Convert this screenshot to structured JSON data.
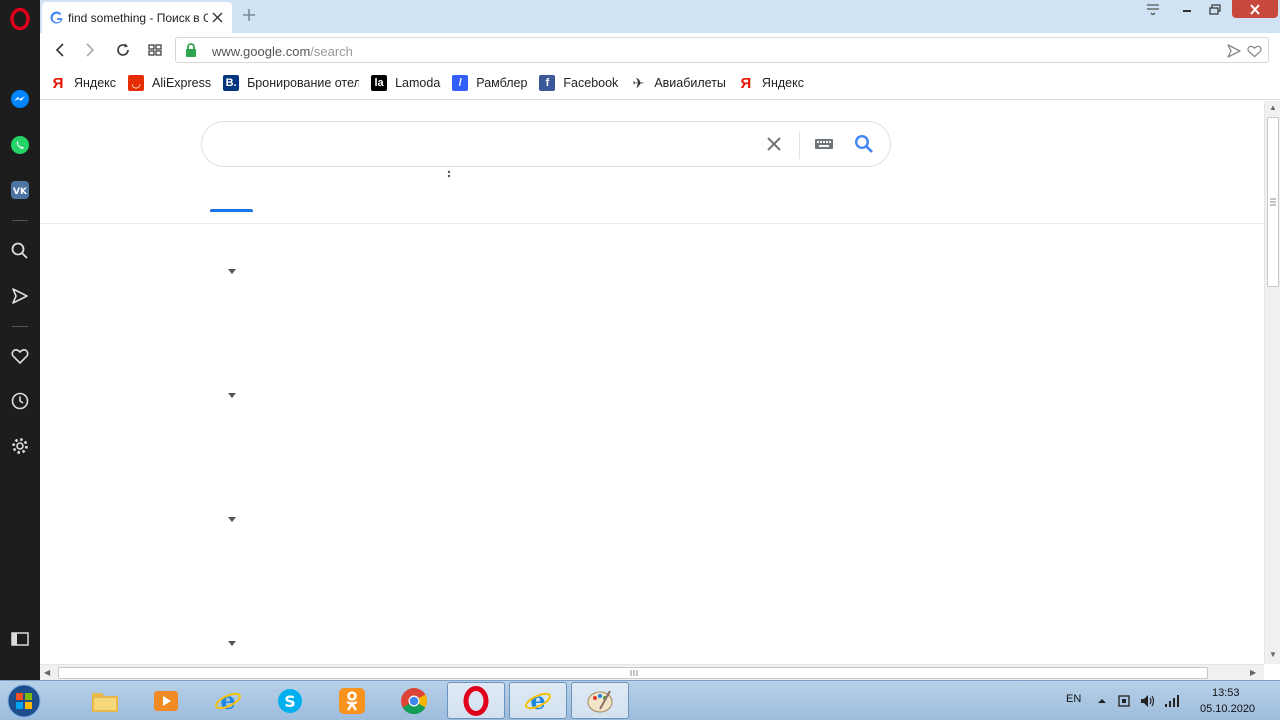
{
  "browser": {
    "tab": {
      "title": "find something - Поиск в Google",
      "favicon": "G"
    },
    "address": {
      "host": "www.google.com",
      "path": "/search"
    },
    "bookmarks": [
      {
        "label": "Яндекс",
        "icon": "yandex-icon",
        "color": "#e61400",
        "glyph": "Я"
      },
      {
        "label": "AliExpress",
        "icon": "aliexpress-icon",
        "color": "#e62e04",
        "glyph": "◡"
      },
      {
        "label": "Бронирование отелей",
        "icon": "booking-icon",
        "color": "#003580",
        "glyph": "B."
      },
      {
        "label": "Lamoda",
        "icon": "lamoda-icon",
        "color": "#000000",
        "glyph": "la"
      },
      {
        "label": "Рамблер",
        "icon": "rambler-icon",
        "color": "#315efb",
        "glyph": "/"
      },
      {
        "label": "Facebook",
        "icon": "facebook-icon",
        "color": "#3b5998",
        "glyph": "f"
      },
      {
        "label": "Авиабилеты",
        "icon": "plane-icon",
        "color": "#f5a623",
        "glyph": "✈"
      },
      {
        "label": "Яндекс",
        "icon": "yandex-icon",
        "color": "#e61400",
        "glyph": "Я"
      }
    ]
  },
  "search": {
    "query": ""
  },
  "taskbar": {
    "lang": "EN",
    "time": "13:53",
    "date": "05.10.2020"
  },
  "colors": {
    "accent": "#1a73e8",
    "sidebar_bg": "#1d1d1d",
    "tabbar_bg": "#cfe3f5",
    "opera_red": "#e0001b"
  }
}
